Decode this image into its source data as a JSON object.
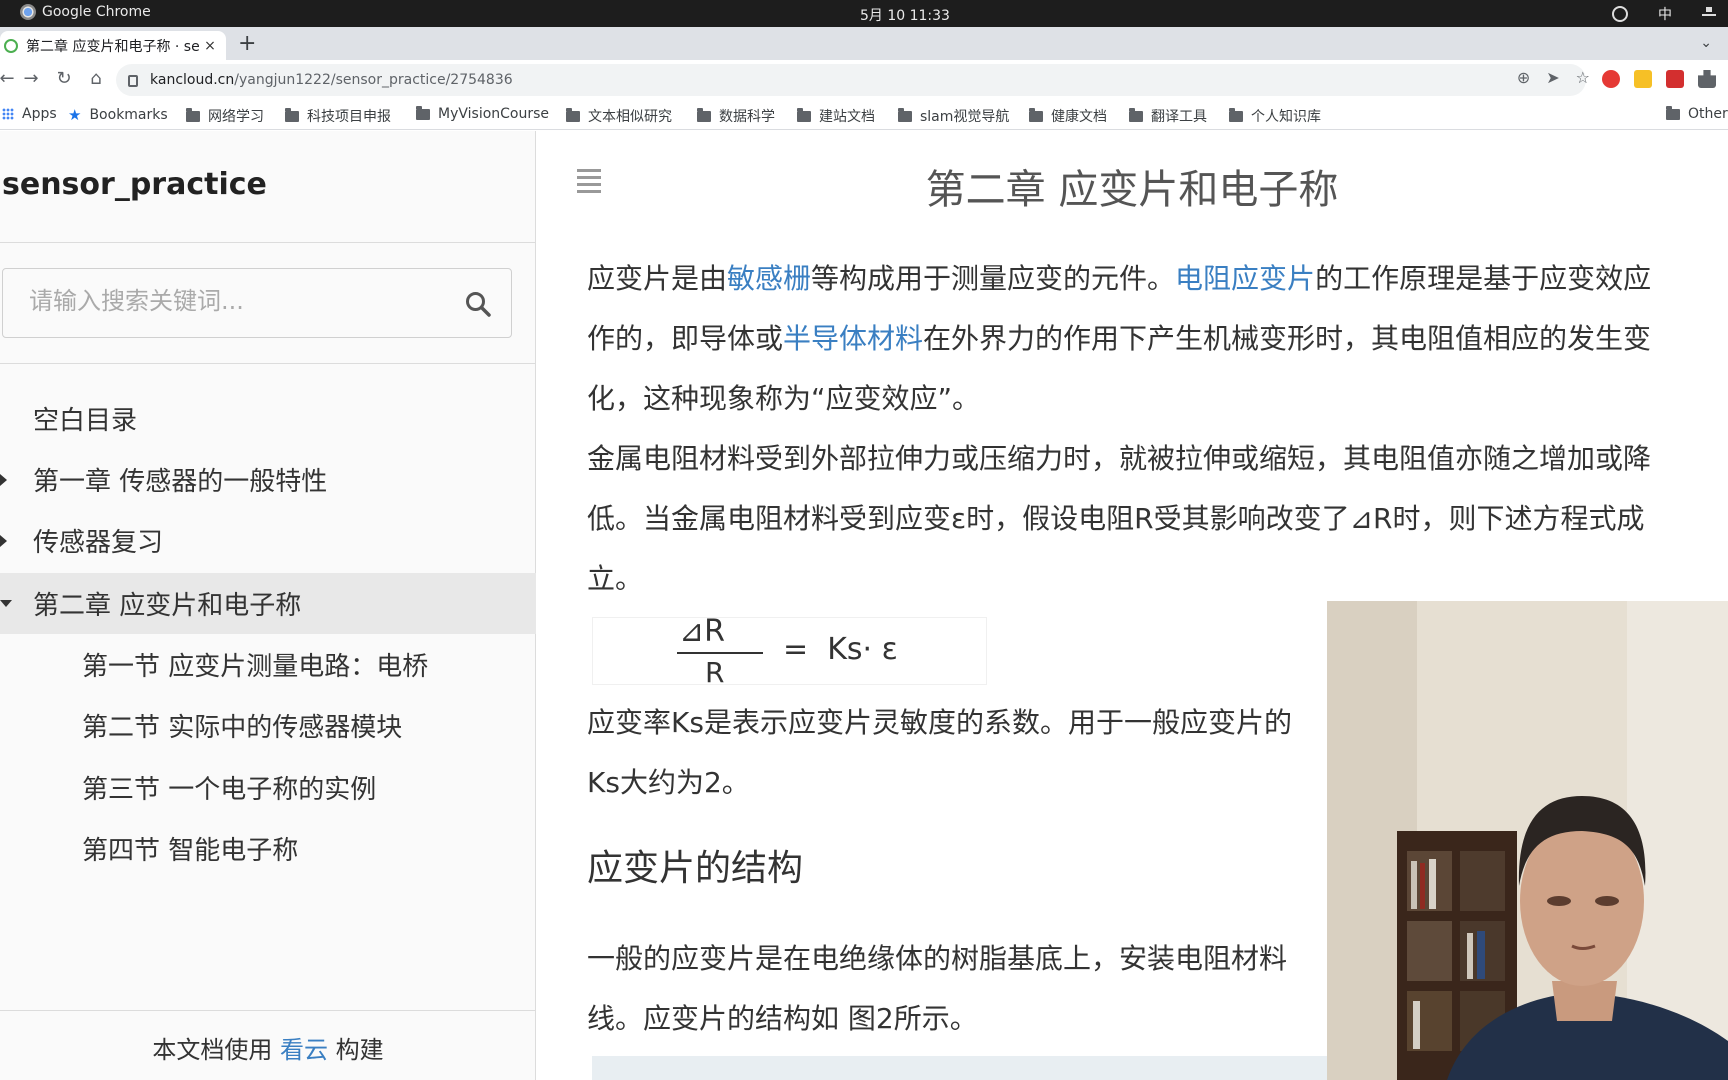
{
  "os_bar": {
    "app_name": "Google Chrome",
    "clock": "5月 10  11:33",
    "ime": "中"
  },
  "browser": {
    "tab_title": "第二章 应变片和电子称 · se",
    "tab_close": "×",
    "new_tab": "+",
    "url_domain": "kancloud.cn",
    "url_path": "/yangjun1222/sensor_practice/2754836",
    "bookmarks": [
      {
        "label": "Apps",
        "icon": "apps-grid-icon"
      },
      {
        "label": "Bookmarks",
        "icon": "star-icon"
      },
      {
        "label": "网络学习",
        "icon": "folder-icon"
      },
      {
        "label": "科技项目申报",
        "icon": "folder-icon"
      },
      {
        "label": "MyVisionCourse",
        "icon": "folder-icon"
      },
      {
        "label": "文本相似研究",
        "icon": "folder-icon"
      },
      {
        "label": "数据科学",
        "icon": "folder-icon"
      },
      {
        "label": "建站文档",
        "icon": "folder-icon"
      },
      {
        "label": "slam视觉导航",
        "icon": "folder-icon"
      },
      {
        "label": "健康文档",
        "icon": "folder-icon"
      },
      {
        "label": "翻译工具",
        "icon": "folder-icon"
      },
      {
        "label": "个人知识库",
        "icon": "folder-icon"
      },
      {
        "label": "Other",
        "icon": "folder-icon"
      }
    ]
  },
  "sidebar": {
    "title": "sensor_practice",
    "search_placeholder": "请输入搜索关键词...",
    "toc": [
      {
        "label": "空白目录"
      },
      {
        "label": "第一章 传感器的一般特性"
      },
      {
        "label": "传感器复习"
      },
      {
        "label": "第二章 应变片和电子称"
      },
      {
        "label": "第一节 应变片测量电路：电桥"
      },
      {
        "label": "第二节 实际中的传感器模块"
      },
      {
        "label": "第三节 一个电子称的实例"
      },
      {
        "label": "第四节 智能电子称"
      }
    ],
    "footer_prefix": "本文档使用",
    "footer_link": "看云",
    "footer_suffix": "构建"
  },
  "content": {
    "title": "第二章 应变片和电子称",
    "p1_l1_a": "应变片是由",
    "p1_l1_link1": "敏感栅",
    "p1_l1_b": "等构成用于测量应变的元件。",
    "p1_l1_link2": "电阻应变片",
    "p1_l1_c": "的工作原理是基于应变效应",
    "p1_l2_a": "作的，即导体或",
    "p1_l2_link": "半导体材料",
    "p1_l2_b": "在外界力的作用下产生机械变形时，其电阻值相应的发生变",
    "p1_l3": "化，这种现象称为“应变效应”。",
    "p2_l1": "金属电阻材料受到外部拉伸力或压缩力时，就被拉伸或缩短，其电阻值亦随之增加或降",
    "p2_l2": "低。当金属电阻材料受到应变ε时，假设电阻R受其影响改变了⊿R时，则下述方程式成",
    "p2_l3": "立。",
    "formula": {
      "numerator": "⊿R",
      "denominator": "R",
      "rhs": "=  Ks· ε"
    },
    "p3_l1": "应变率Ks是表示应变片灵敏度的系数。用于一般应变片的",
    "p3_l2": "Ks大约为2。",
    "h2": "应变片的结构",
    "p4_l1": "一般的应变片是在电绝缘体的树脂基底上，安装电阻材料",
    "p4_l2": "线。应变片的结构如 图2所示。"
  },
  "colors": {
    "link": "#3a7fc2",
    "sidebar_bg": "#fafafa",
    "active_toc_bg": "#e8e8e8"
  }
}
